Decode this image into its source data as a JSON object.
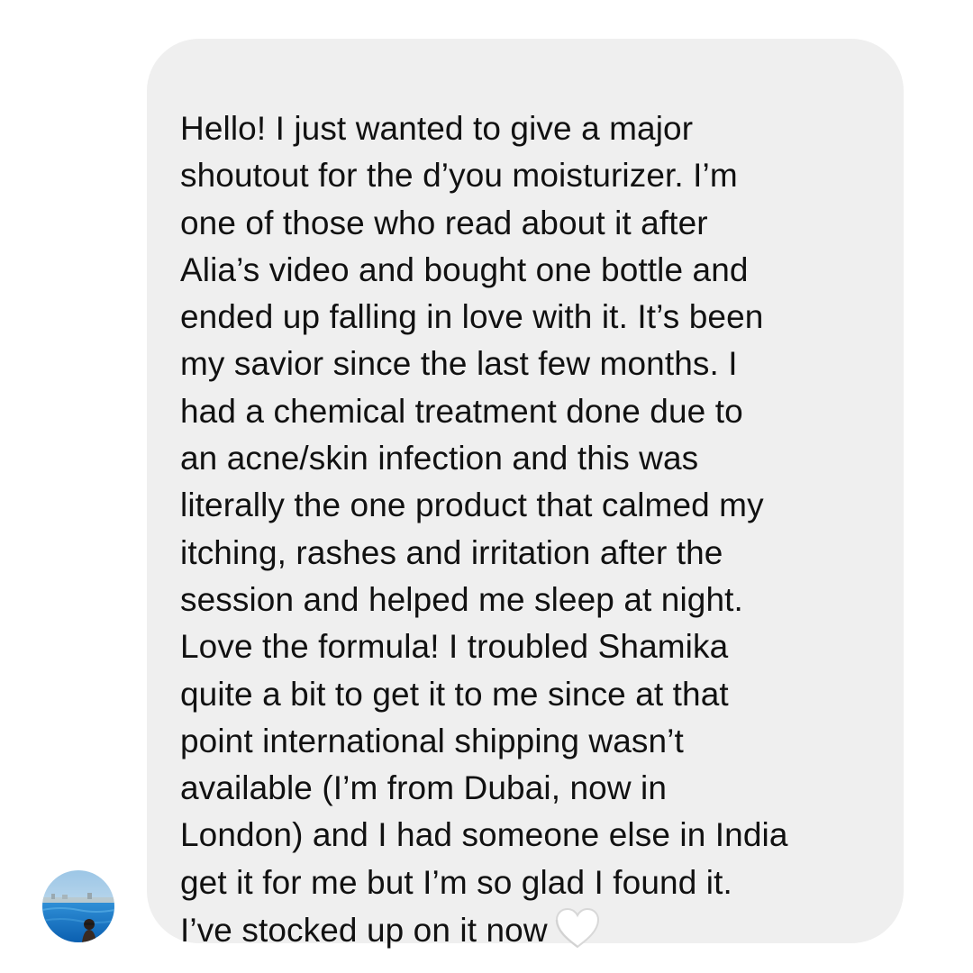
{
  "message": {
    "lines": [
      "Hello! I just wanted to give a major",
      "shoutout for the d’you moisturizer. I’m",
      "one of those who read about it after",
      "Alia’s video and bought one bottle and",
      "ended up falling in love with it. It’s been",
      "my savior since the last few months. I",
      "had a chemical treatment done due to",
      "an acne/skin infection and this was",
      "literally the one product that calmed my",
      "itching, rashes and irritation after the",
      "session and helped me sleep at night.",
      "Love the formula! I troubled Shamika",
      "quite a bit to get it to me since at that",
      "point international shipping wasn’t",
      "available (I’m from Dubai, now in",
      "London) and I had someone else in India",
      "get it for me but I’m so glad I found it.",
      "I’ve stocked up on it now"
    ],
    "trailing_emoji": "white-heart-icon"
  },
  "avatar": {
    "icon": "avatar-photo"
  },
  "colors": {
    "bubble_background": "#efefef",
    "text": "#111111",
    "heart_fill": "#ffffff",
    "heart_stroke": "#d8d8d8"
  }
}
